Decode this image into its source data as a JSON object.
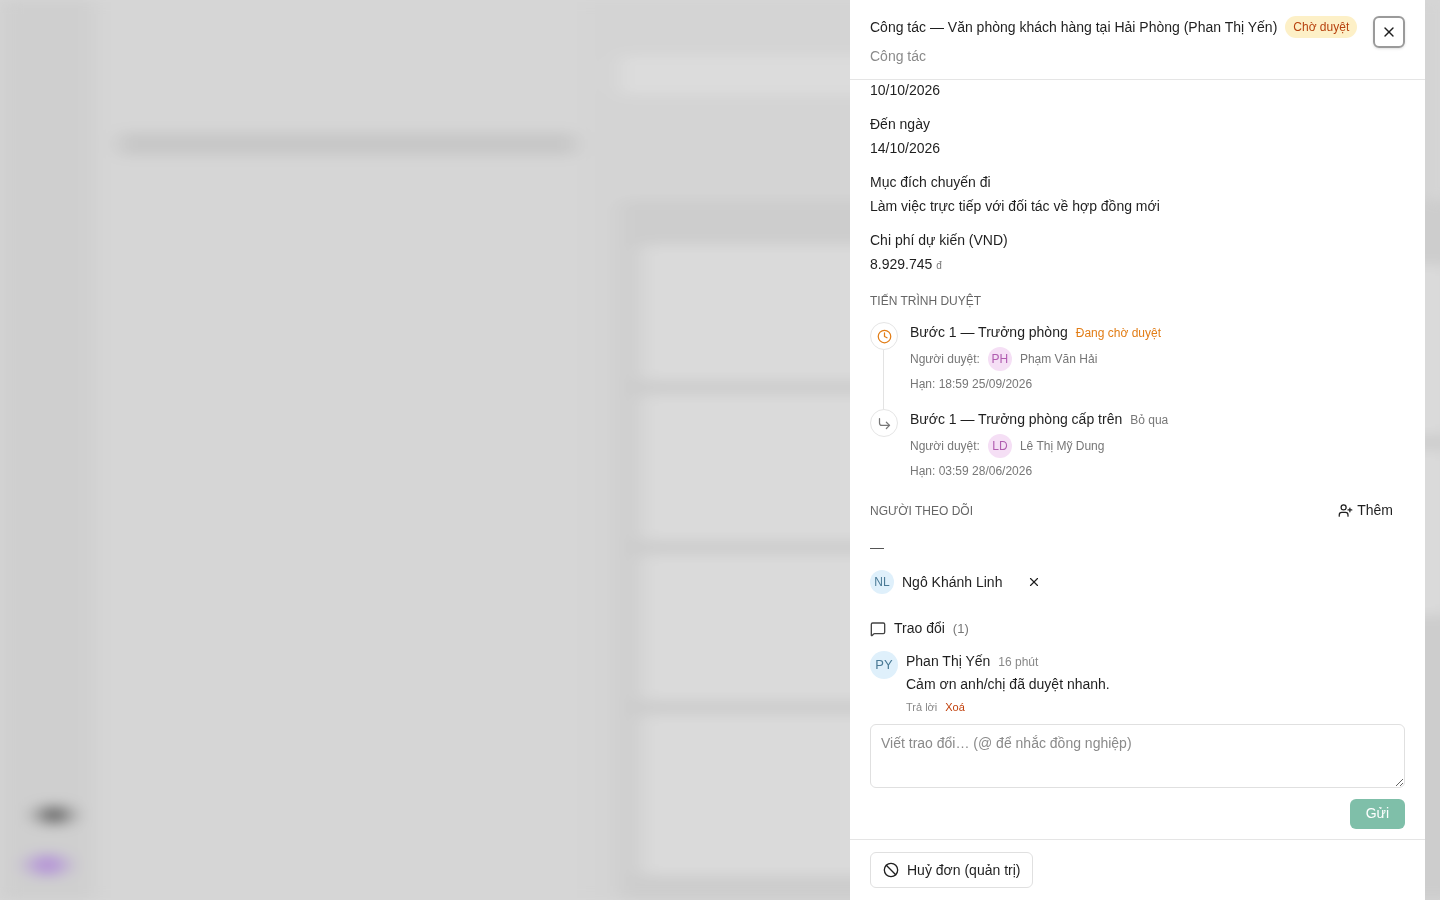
{
  "header": {
    "title": "Công tác — Văn phòng khách hàng tại Hải Phòng (Phan Thị Yến)",
    "status_badge": "Chờ duyệt",
    "subtitle": "Công tác"
  },
  "fields": [
    {
      "value": "10/10/2026"
    },
    {
      "label": "Đến ngày",
      "value": "14/10/2026"
    },
    {
      "label": "Mục đích chuyến đi",
      "value": "Làm việc trực tiếp với đối tác về hợp đồng mới"
    },
    {
      "label": "Chi phí dự kiến (VND)",
      "value": "8.929.745",
      "unit": "đ"
    }
  ],
  "approval": {
    "heading": "TIẾN TRÌNH DUYỆT",
    "steps": [
      {
        "kind": "pending",
        "title": "Bước 1 — Trưởng phòng",
        "status": "Đang chờ duyệt",
        "approver_label": "Người duyệt:",
        "approver_initials": "PH",
        "approver": "Phạm Văn Hải",
        "deadline": "Hạn: 18:59 25/09/2026"
      },
      {
        "kind": "skipped",
        "title": "Bước 1 — Trưởng phòng cấp trên",
        "status": "Bỏ qua",
        "approver_label": "Người duyệt:",
        "approver_initials": "LD",
        "approver": "Lê Thị Mỹ Dung",
        "deadline": "Hạn: 03:59 28/06/2026"
      }
    ]
  },
  "followers": {
    "heading": "NGƯỜI THEO DÕI",
    "add_button": "Thêm",
    "empty_mark": "—",
    "people": [
      {
        "initials": "NL",
        "name": "Ngô Khánh Linh"
      }
    ]
  },
  "discussion": {
    "heading": "Trao đổi",
    "count": "(1)",
    "comments": [
      {
        "initials": "PY",
        "author": "Phan Thị Yến",
        "time": "16 phút",
        "text": "Cảm ơn anh/chị đã duyệt nhanh.",
        "reply": "Trả lời",
        "delete": "Xoá"
      }
    ],
    "input": {
      "placeholder": "Viết trao đổi… (@ để nhắc đồng nghiệp)"
    },
    "send_button": "Gửi"
  },
  "footer": {
    "cancel_button": "Huỷ đơn (quản trị)"
  }
}
